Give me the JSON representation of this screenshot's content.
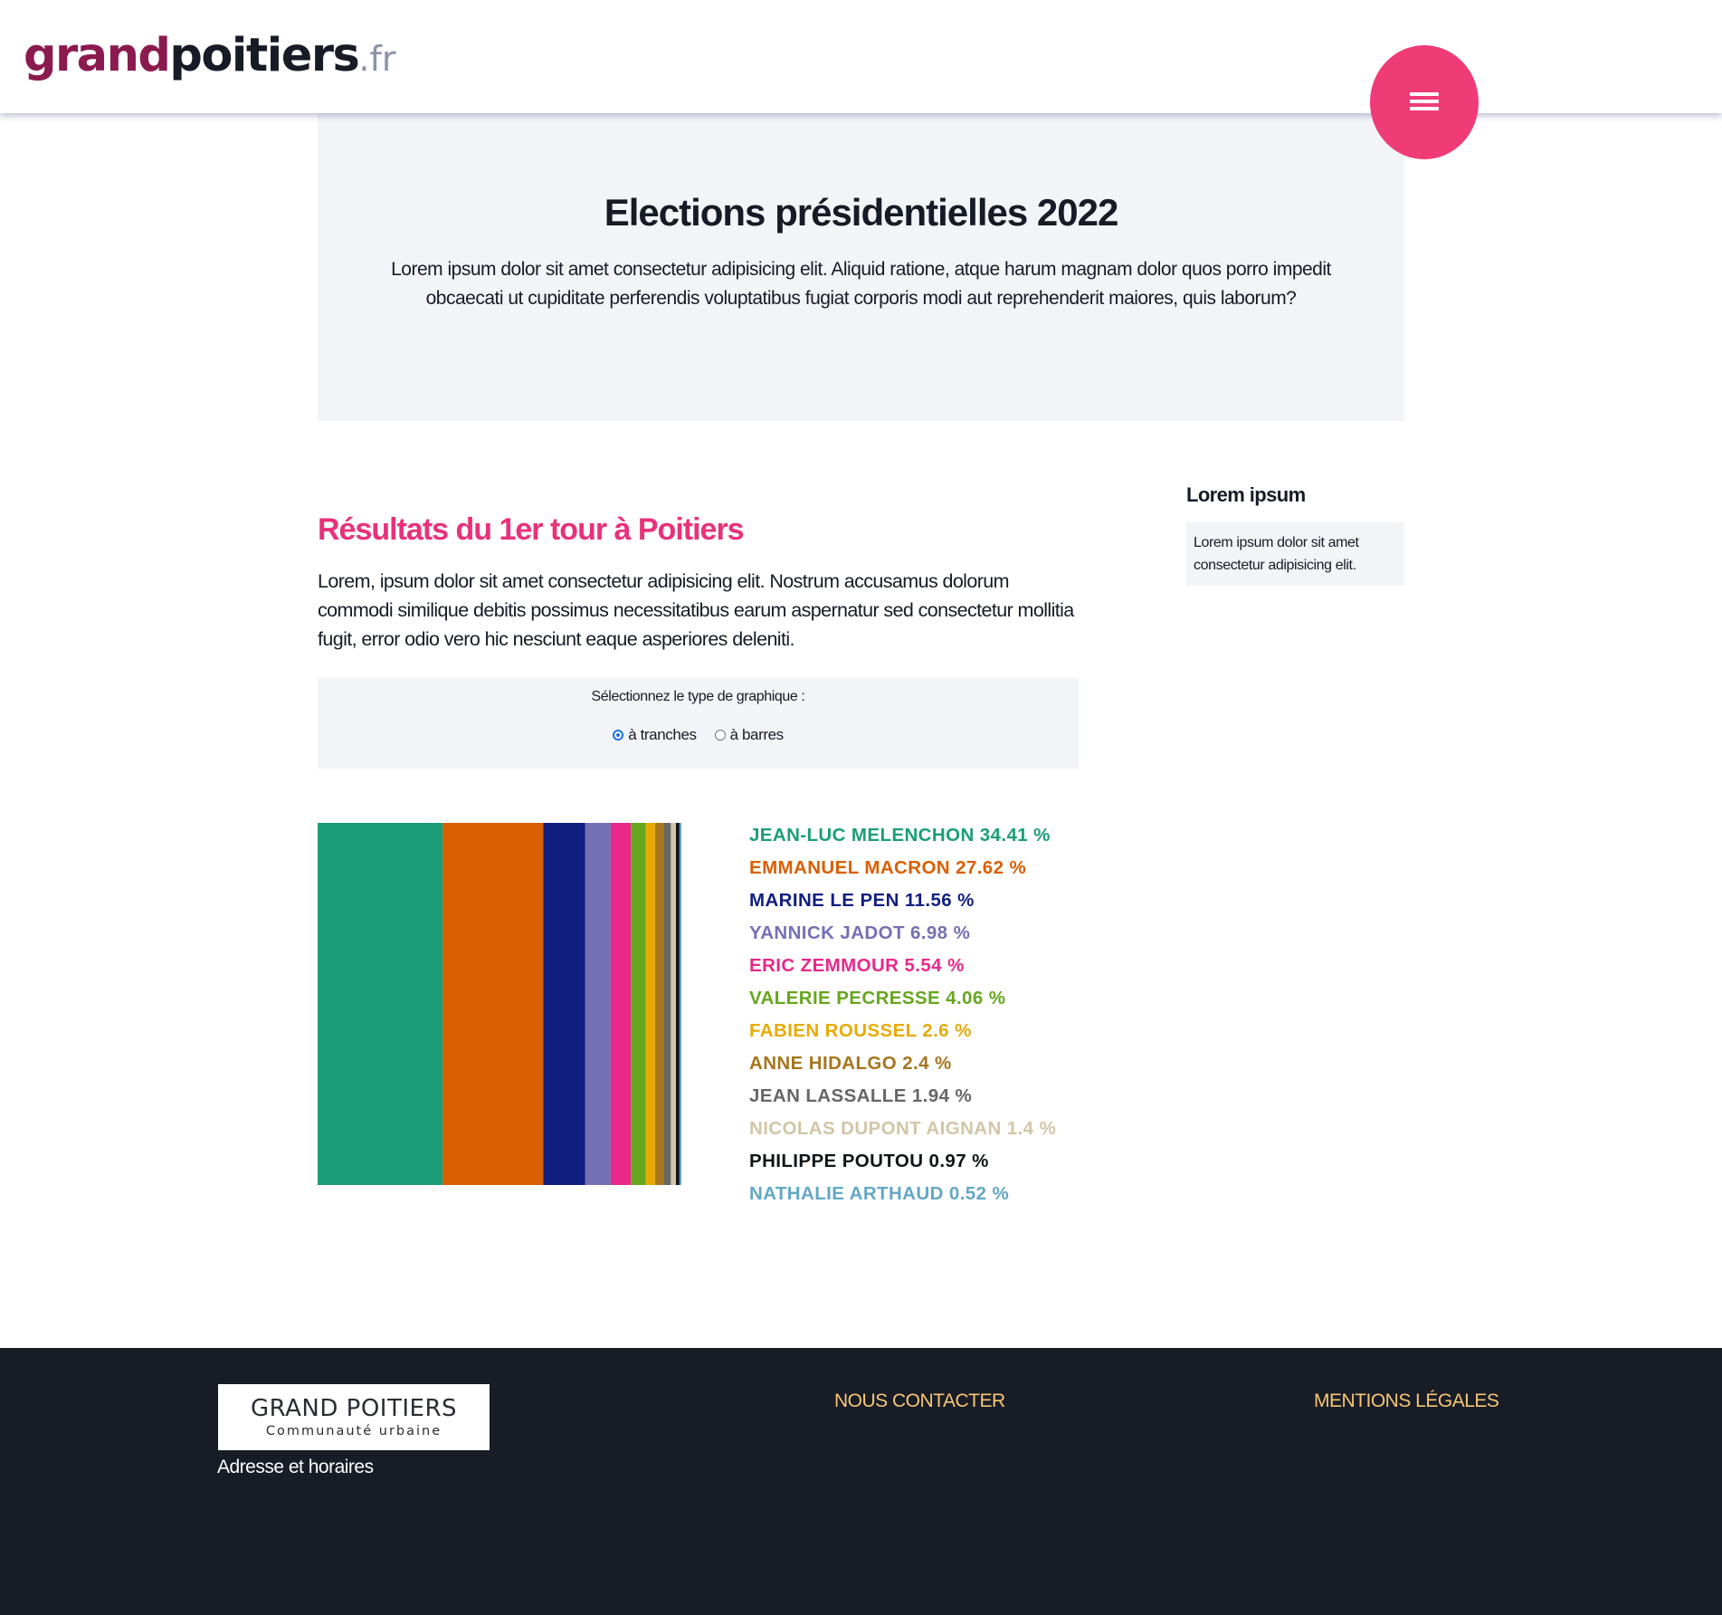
{
  "header": {
    "logo_grand": "grand",
    "logo_poitiers": "poitiers",
    "logo_tld": ".fr",
    "menu_icon": "hamburger-icon",
    "menu_color": "#ef3b76"
  },
  "hero": {
    "title": "Elections présidentielles 2022",
    "text": "Lorem ipsum dolor sit amet consectetur adipisicing elit. Aliquid ratione, atque harum magnam dolor quos porro impedit obcaecati ut cupiditate perferendis voluptatibus fugiat corporis modi aut reprehenderit maiores, quis laborum?"
  },
  "results": {
    "title": "Résultats du 1er tour à Poitiers",
    "text": "Lorem, ipsum dolor sit amet consectetur adipisicing elit. Nostrum accusamus dolorum commodi similique debitis possimus necessitatibus earum aspernatur sed consectetur mollitia fugit, error odio vero hic nesciunt eaque asperiores deleniti.",
    "chart_type_prompt": "Sélectionnez le type de graphique :",
    "options": [
      {
        "label": "à tranches",
        "selected": true
      },
      {
        "label": "à barres",
        "selected": false
      }
    ]
  },
  "chart_data": {
    "type": "bar",
    "orientation": "stacked-horizontal-100",
    "unit": "%",
    "series": [
      {
        "name": "JEAN-LUC MELENCHON",
        "value": 34.41,
        "color": "#1b9e77"
      },
      {
        "name": "EMMANUEL MACRON",
        "value": 27.62,
        "color": "#d95f02"
      },
      {
        "name": "MARINE LE PEN",
        "value": 11.56,
        "color": "#101f80"
      },
      {
        "name": "YANNICK JADOT",
        "value": 6.98,
        "color": "#7570b3"
      },
      {
        "name": "ERIC ZEMMOUR",
        "value": 5.54,
        "color": "#e7298a"
      },
      {
        "name": "VALERIE PECRESSE",
        "value": 4.06,
        "color": "#66a61e"
      },
      {
        "name": "FABIEN ROUSSEL",
        "value": 2.6,
        "color": "#e6ab02"
      },
      {
        "name": "ANNE HIDALGO",
        "value": 2.4,
        "color": "#a6761d"
      },
      {
        "name": "JEAN LASSALLE",
        "value": 1.94,
        "color": "#666666"
      },
      {
        "name": "NICOLAS DUPONT AIGNAN",
        "value": 1.4,
        "color": "#d2c5a7"
      },
      {
        "name": "PHILIPPE POUTOU",
        "value": 0.97,
        "color": "#0f1419"
      },
      {
        "name": "NATHALIE ARTHAUD",
        "value": 0.52,
        "color": "#63a7c4"
      }
    ]
  },
  "aside": {
    "title": "Lorem ipsum",
    "text": "Lorem ipsum dolor sit amet consectetur adipisicing elit."
  },
  "footer": {
    "logo_line1": "GRAND POITIERS",
    "logo_line2": "Communauté urbaine",
    "address": "Adresse et horaires",
    "contact": "NOUS CONTACTER",
    "legal": "MENTIONS LÉGALES",
    "link_color": "#f5c774"
  }
}
